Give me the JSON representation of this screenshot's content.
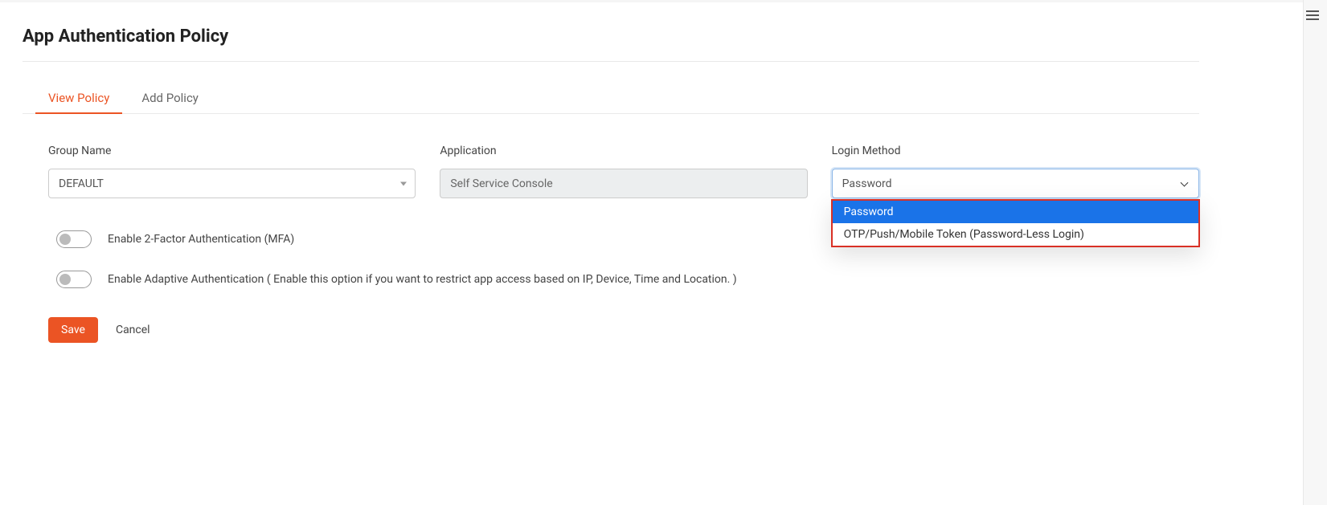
{
  "page": {
    "title": "App Authentication Policy"
  },
  "tabs": {
    "view": "View Policy",
    "add": "Add Policy"
  },
  "fields": {
    "groupName": {
      "label": "Group Name",
      "value": "DEFAULT"
    },
    "application": {
      "label": "Application",
      "value": "Self Service Console"
    },
    "loginMethod": {
      "label": "Login Method",
      "value": "Password",
      "options": [
        "Password",
        "OTP/Push/Mobile Token (Password-Less Login)"
      ]
    }
  },
  "toggles": {
    "mfa": "Enable 2-Factor Authentication (MFA)",
    "adaptive": "Enable Adaptive Authentication ( Enable this option if you want to restrict app access based on IP, Device, Time and Location. )"
  },
  "buttons": {
    "save": "Save",
    "cancel": "Cancel"
  }
}
